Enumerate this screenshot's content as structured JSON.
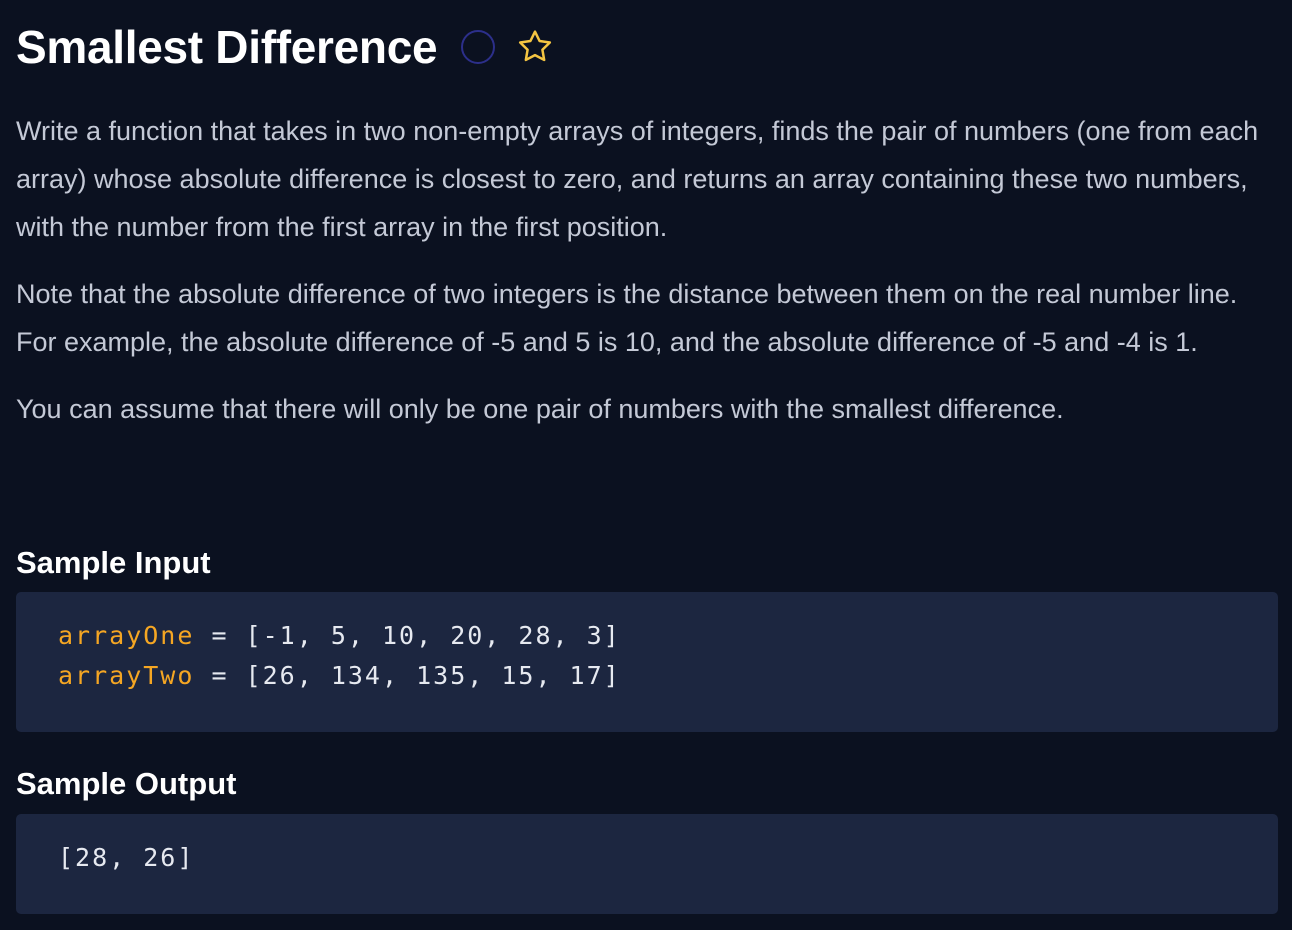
{
  "header": {
    "title": "Smallest Difference",
    "status_icon": "circle-outline-icon",
    "favorite_icon": "star-icon",
    "star_color": "#f5c542",
    "circle_color": "#2c2f8a"
  },
  "description": {
    "paragraphs": [
      "Write a function that takes in two non-empty arrays of integers, finds the pair of numbers (one from each array) whose absolute difference is closest to zero, and returns an array containing these two numbers, with the number from the first array in the first position.",
      "Note that the absolute difference of two integers is the distance between them on the real number line. For example, the absolute difference of -5 and 5 is 10, and the absolute difference of -5 and -4 is 1.",
      "You can assume that there will only be one pair of numbers with the smallest difference."
    ]
  },
  "sample_input": {
    "heading": "Sample Input",
    "lines": [
      {
        "var": "arrayOne",
        "rest": " = [-1, 5, 10, 20, 28, 3]"
      },
      {
        "var": "arrayTwo",
        "rest": " = [26, 134, 135, 15, 17]"
      }
    ]
  },
  "sample_output": {
    "heading": "Sample Output",
    "value": "[28, 26]"
  },
  "colors": {
    "background": "#0b1120",
    "code_background": "#1c2640",
    "variable": "#f5a623"
  }
}
